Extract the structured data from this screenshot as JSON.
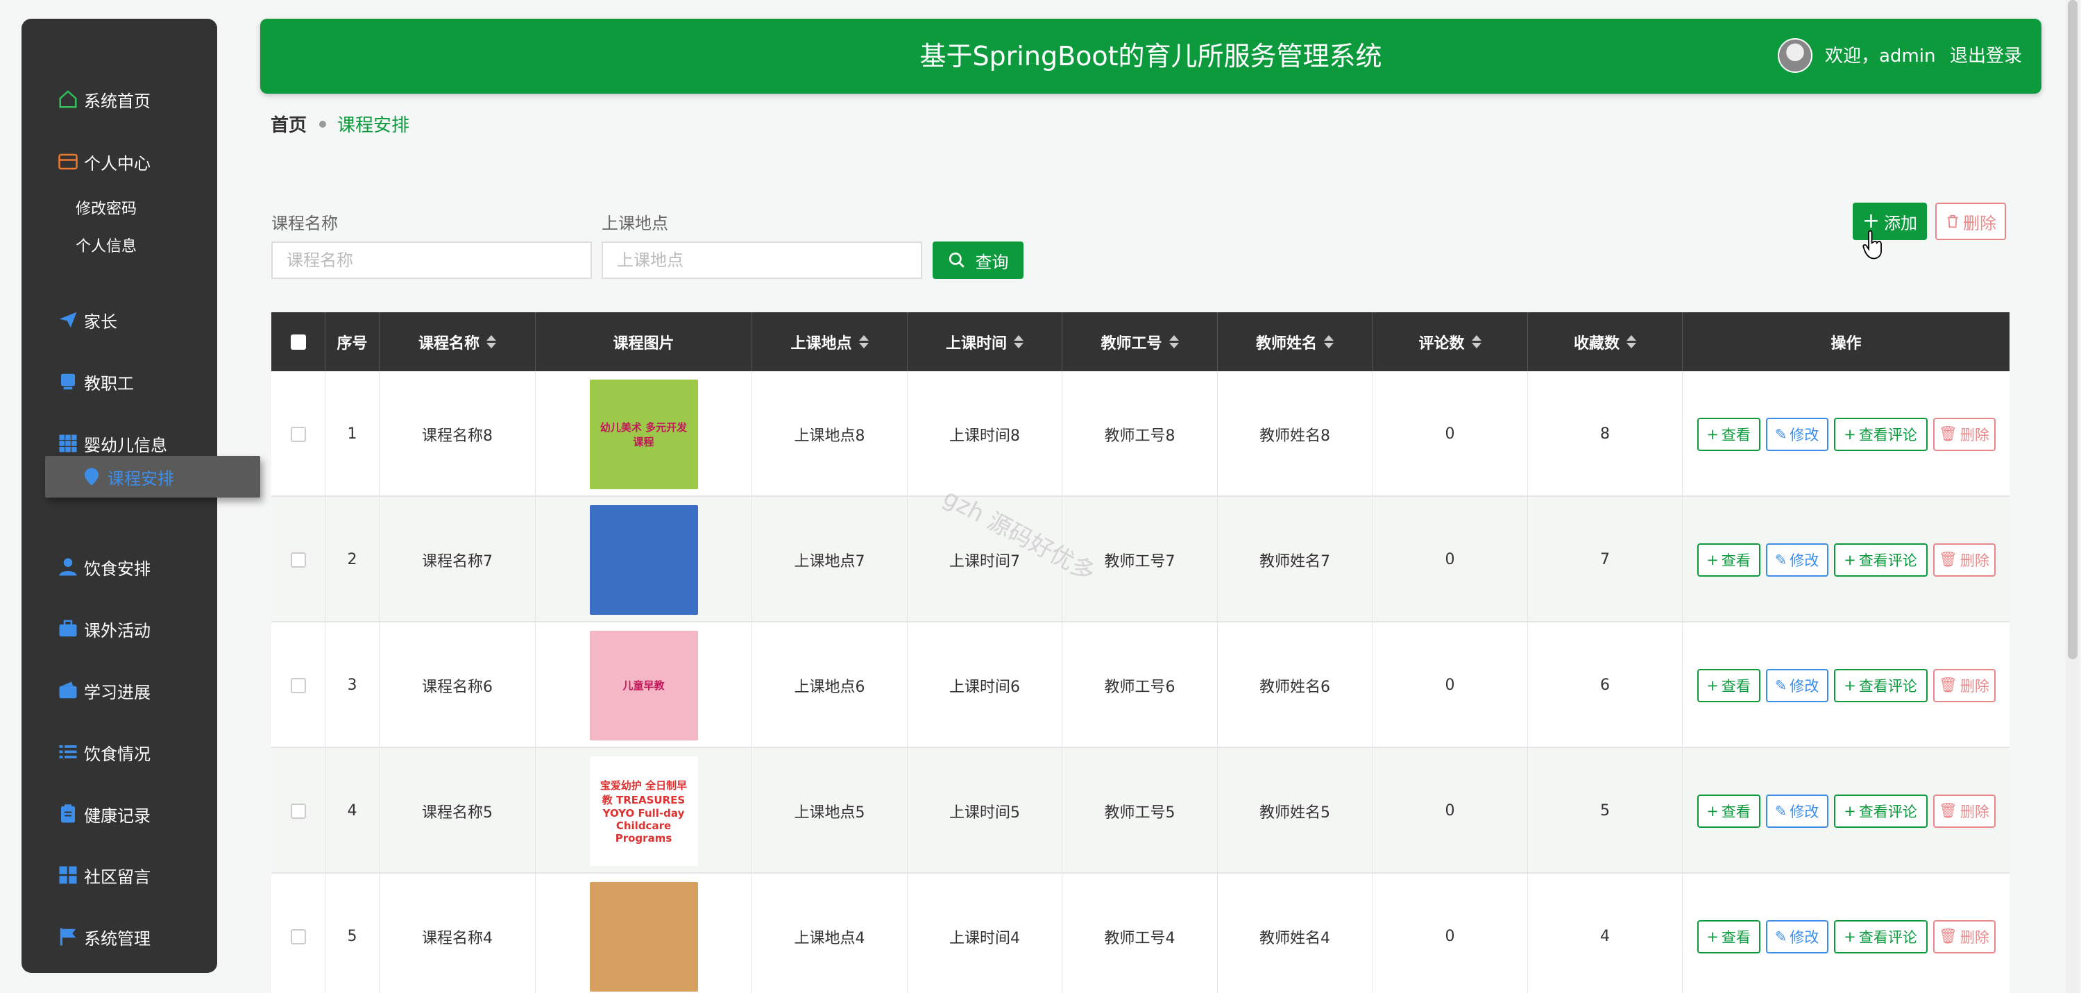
{
  "sidebar": {
    "items": [
      {
        "label": "系统首页",
        "icon": "home-icon"
      },
      {
        "label": "个人中心",
        "icon": "card-icon"
      },
      {
        "label": "家长",
        "icon": "send-icon"
      },
      {
        "label": "教职工",
        "icon": "monitor-icon"
      },
      {
        "label": "婴幼儿信息",
        "icon": "grid-icon"
      },
      {
        "label": "课程安排",
        "icon": "location-icon",
        "active": true
      },
      {
        "label": "饮食安排",
        "icon": "user-icon"
      },
      {
        "label": "课外活动",
        "icon": "briefcase-icon"
      },
      {
        "label": "学习进展",
        "icon": "wallet-icon"
      },
      {
        "label": "饮食情况",
        "icon": "list-icon"
      },
      {
        "label": "健康记录",
        "icon": "clipboard-icon"
      },
      {
        "label": "社区留言",
        "icon": "apps-icon"
      },
      {
        "label": "系统管理",
        "icon": "flag-icon"
      }
    ],
    "sub_items": [
      "修改密码",
      "个人信息"
    ]
  },
  "header": {
    "title": "基于SpringBoot的育儿所服务管理系统",
    "welcome": "欢迎，admin",
    "logout": "退出登录"
  },
  "breadcrumb": {
    "home": "首页",
    "current": "课程安排"
  },
  "search": {
    "name_label": "课程名称",
    "name_placeholder": "课程名称",
    "place_label": "上课地点",
    "place_placeholder": "上课地点",
    "query_label": "查询"
  },
  "actions": {
    "add_label": "添加",
    "delete_label": "删除"
  },
  "table": {
    "headers": [
      "序号",
      "课程名称",
      "课程图片",
      "上课地点",
      "上课时间",
      "教师工号",
      "教师姓名",
      "评论数",
      "收藏数",
      "操作"
    ],
    "ops": {
      "view": "查看",
      "edit": "修改",
      "view_comments": "查看评论",
      "delete": "删除"
    },
    "rows": [
      {
        "idx": "1",
        "name": "课程名称8",
        "place": "上课地点8",
        "time": "上课时间8",
        "tno": "教师工号8",
        "tname": "教师姓名8",
        "comments": "0",
        "favs": "8",
        "img": {
          "text": "幼儿美术 多元开发课程",
          "color": "#9cc94a"
        }
      },
      {
        "idx": "2",
        "name": "课程名称7",
        "place": "上课地点7",
        "time": "上课时间7",
        "tno": "教师工号7",
        "tname": "教师姓名7",
        "comments": "0",
        "favs": "7",
        "img": {
          "text": "",
          "color": "#3a6fc4"
        }
      },
      {
        "idx": "3",
        "name": "课程名称6",
        "place": "上课地点6",
        "time": "上课时间6",
        "tno": "教师工号6",
        "tname": "教师姓名6",
        "comments": "0",
        "favs": "6",
        "img": {
          "text": "儿童早教",
          "color": "#f5b6c6"
        }
      },
      {
        "idx": "4",
        "name": "课程名称5",
        "place": "上课地点5",
        "time": "上课时间5",
        "tno": "教师工号5",
        "tname": "教师姓名5",
        "comments": "0",
        "favs": "5",
        "img": {
          "text": "宝爱幼护 全日制早教 TREASURES YOYO Full-day Childcare Programs",
          "color": "#ffffff"
        }
      },
      {
        "idx": "5",
        "name": "课程名称4",
        "place": "上课地点4",
        "time": "上课时间4",
        "tno": "教师工号4",
        "tname": "教师姓名4",
        "comments": "0",
        "favs": "4",
        "img": {
          "text": "",
          "color": "#d8a060"
        }
      }
    ]
  },
  "watermark": "gzh 源码好优多",
  "colors": {
    "primary": "#0c9a3d",
    "sidebar_bg": "#333333",
    "active_icon": "#3d8ee8",
    "danger": "#e9888a"
  }
}
